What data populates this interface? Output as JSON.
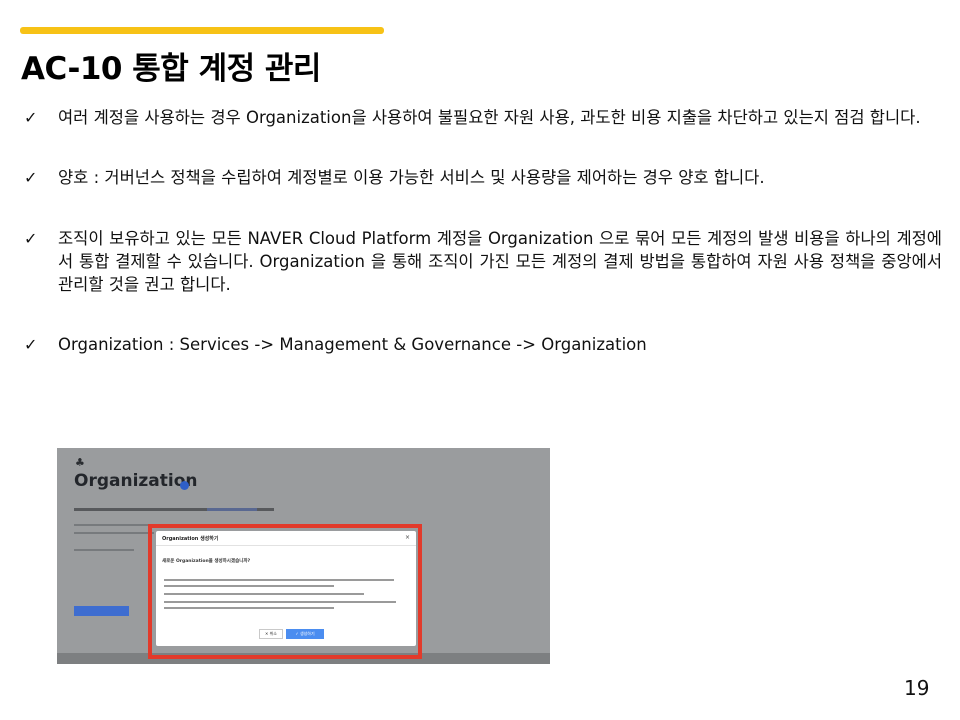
{
  "slide": {
    "title": "AC-10 통합 계정 관리",
    "page_number": "19",
    "accent_color": "#f7c216"
  },
  "bullets": [
    {
      "icon": "check-icon",
      "text": "여러 계정을 사용하는 경우 Organization을 사용하여 불필요한 자원 사용, 과도한 비용 지출을 차단하고 있는지 점검 합니다."
    },
    {
      "icon": "check-icon",
      "text": "양호 : 거버넌스 정책을 수립하여 계정별로 이용 가능한 서비스 및 사용량을 제어하는 경우 양호 합니다."
    },
    {
      "icon": "check-icon",
      "text": "조직이 보유하고 있는 모든 NAVER Cloud Platform 계정을 Organization 으로 묶어 모든 계정의 발생 비용을 하나의 계정에서 통합 결제할 수 있습니다. Organization 을 통해 조직이 가진 모든 계정의 결제 방법을 통합하여 자원 사용 정책을 중앙에서 관리할 것을 권고 합니다."
    },
    {
      "icon": "check-icon",
      "text": "Organization : Services -> Management & Governance -> Organization"
    }
  ],
  "screenshot": {
    "page_title": "Organization",
    "dialog_title": "Organization 생성하기",
    "dialog_question": "새로운 Organization을 생성하시겠습니까?",
    "cancel_label": "✕ 취소",
    "confirm_label": "✓ 생성하기",
    "highlight_color": "#e23a2b"
  }
}
